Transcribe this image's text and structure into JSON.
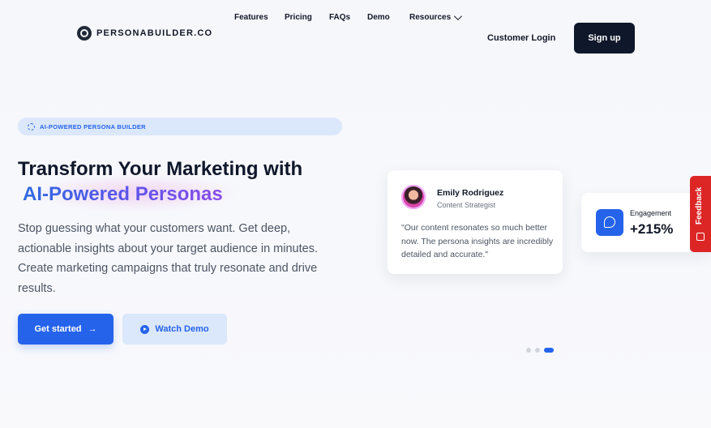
{
  "brand": {
    "name": "PERSONABUILDER.CO"
  },
  "nav": {
    "items": [
      "Features",
      "Pricing",
      "FAQs",
      "Demo",
      "Resources"
    ]
  },
  "header": {
    "login_label": "Customer Login",
    "signup_label": "Sign up"
  },
  "hero": {
    "badge": "AI-POWERED PERSONA BUILDER",
    "title_line1": "Transform Your Marketing with",
    "title_accent": "AI-Powered Personas",
    "lead": "Stop guessing what your customers want. Get deep, actionable insights about your target audience in minutes. Create marketing campaigns that truly resonate and drive results.",
    "primary_cta": "Get started",
    "secondary_cta": "Watch Demo"
  },
  "testimonial": {
    "name": "Emily Rodriguez",
    "role": "Content Strategist",
    "quote": "\"Our content resonates so much better now. The persona insights are incredibly detailed and accurate.\""
  },
  "stat": {
    "label": "Engagement",
    "value": "+215%"
  },
  "feedback": {
    "label": "Feedback"
  },
  "carousel": {
    "count": 3,
    "active_index": 2
  },
  "colors": {
    "accent": "#2563eb",
    "dark": "#0f172a",
    "feedback": "#dc2626"
  },
  "icons": [
    "logo-icon",
    "chevron-down-icon",
    "sparkle-icon",
    "arrow-right-icon",
    "play-icon",
    "chat-icon",
    "feedback-icon"
  ]
}
